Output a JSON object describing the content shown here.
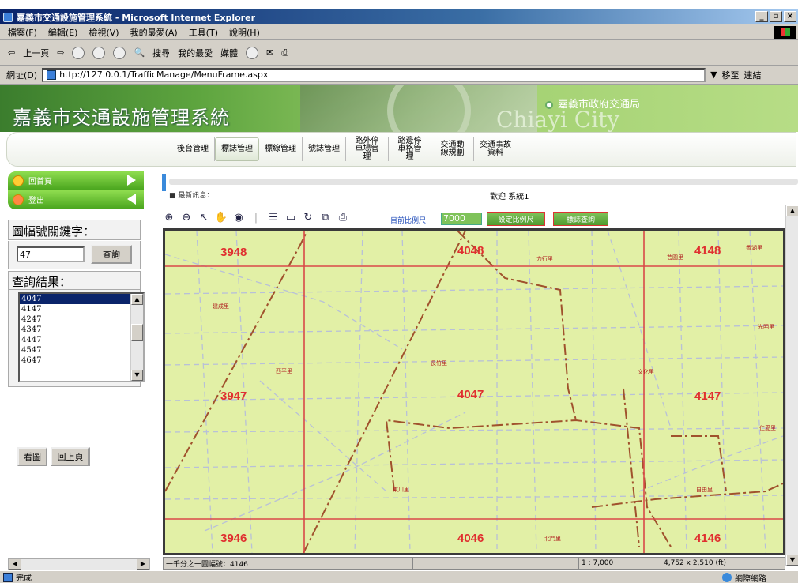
{
  "browser": {
    "window_title": "嘉義市交通設施管理系統 - Microsoft Internet Explorer",
    "menu": [
      "檔案(F)",
      "編輯(E)",
      "檢視(V)",
      "我的最愛(A)",
      "工具(T)",
      "說明(H)"
    ],
    "toolbar": {
      "back": "上一頁",
      "search": "搜尋",
      "favorites": "我的最愛",
      "media": "媒體"
    },
    "address_label": "網址(D)",
    "address_value": "http://127.0.0.1/TrafficManage/MenuFrame.aspx",
    "go_label": "移至",
    "links_label": "連結",
    "status_text": "完成",
    "zone_text": "網際網路"
  },
  "header": {
    "title": "嘉義市交通設施管理系統",
    "bureau": "嘉義市政府交通局",
    "city": "Chiayi City"
  },
  "nav": {
    "items": [
      {
        "label": "後台管理"
      },
      {
        "label": "標誌管理"
      },
      {
        "label": "標線管理"
      },
      {
        "label": "號誌管理"
      },
      {
        "label": "路外停車場管理"
      },
      {
        "label": "路邊停車格管理"
      },
      {
        "label": "交通動線規劃"
      },
      {
        "label": "交通事故資料"
      }
    ]
  },
  "leftnav": {
    "home": "回首頁",
    "logout": "登出"
  },
  "search": {
    "keyword_label": "圖幅號關鍵字：",
    "keyword_value": "47",
    "query_button": "查詢",
    "result_label": "查詢結果：",
    "results": [
      "4047",
      "4147",
      "4247",
      "4347",
      "4447",
      "4547",
      "4647"
    ],
    "view_button": "看圖",
    "back_button": "回上頁"
  },
  "news": {
    "label": "最新訊息：",
    "text": "歡迎 系統1"
  },
  "maptools": {
    "scale_label": "目前比例尺",
    "scale_value": "7000",
    "set_scale_button": "設定比例尺",
    "tag_query_button": "標誌查詢"
  },
  "map": {
    "sheets": [
      "3948",
      "4048",
      "4148",
      "3947",
      "4047",
      "4147",
      "3946",
      "4046",
      "4146"
    ],
    "places": [
      "力行里",
      "芸園里",
      "香湖里",
      "建成里",
      "光明里",
      "長竹里",
      "西平里",
      "文化里",
      "自由里",
      "東川里",
      "仁愛里",
      "北門里"
    ],
    "accent_color": "#e03030",
    "grid_color": "#d94848",
    "base_color": "#e2f0a6"
  },
  "mapstatus": {
    "sheet_info": "一千分之一圖幅號：4146",
    "scale_display": "1 : 7,000",
    "extent": "4,752 x 2,510 (ft)"
  }
}
